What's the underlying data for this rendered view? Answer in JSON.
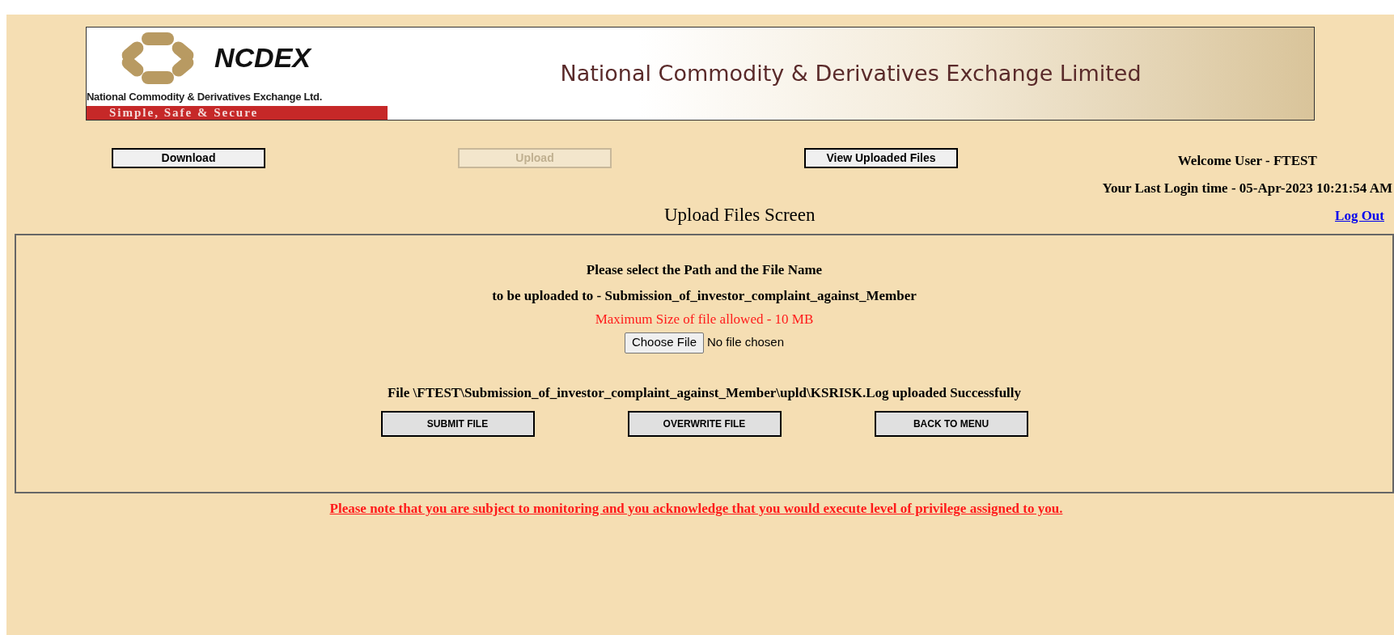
{
  "banner": {
    "logo_text": "NCDEX",
    "logo_subtitle": "National Commodity & Derivatives Exchange Ltd.",
    "tagline": "Simple, Safe & Secure",
    "title": "National Commodity & Derivatives Exchange Limited"
  },
  "nav_buttons": [
    {
      "label": "Download",
      "disabled": false
    },
    {
      "label": "Upload",
      "disabled": true
    },
    {
      "label": "View Uploaded Files",
      "disabled": false
    }
  ],
  "welcome": "Welcome User - FTEST",
  "last_login": "Your Last Login time - 05-Apr-2023 10:21:54 AM",
  "screen_title": "Upload Files Screen",
  "logout": "Log Out",
  "panel": {
    "instruction_1": "Please select the Path and the File Name",
    "instruction_2": "to be uploaded to - Submission_of_investor_complaint_against_Member",
    "size_note": "Maximum Size of file allowed - 10 MB",
    "file_button": "Choose File",
    "file_status": "No file chosen",
    "message": "File \\FTEST\\Submission_of_investor_complaint_against_Member\\upld\\KSRISK.Log uploaded Successfully",
    "buttons": [
      "SUBMIT FILE",
      "OVERWRITE FILE",
      "BACK TO MENU"
    ]
  },
  "footer_note": "Please note that you are subject to monitoring and you acknowledge that you would execute level of privilege assigned to you."
}
